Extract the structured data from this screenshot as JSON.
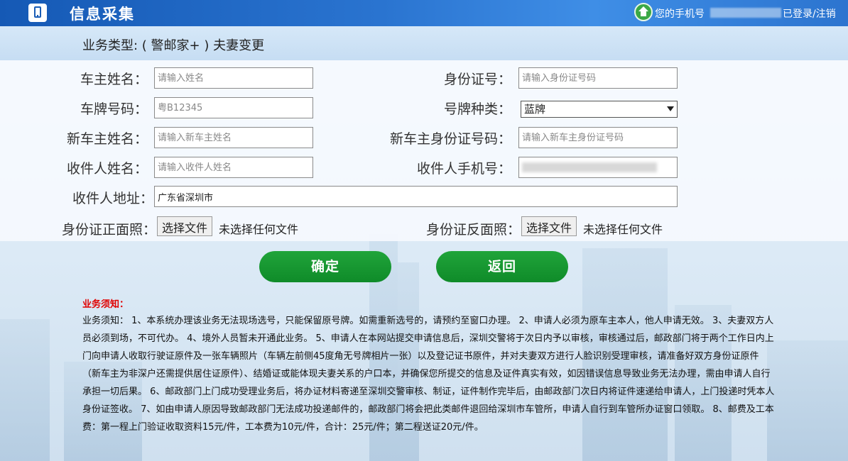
{
  "header": {
    "title": "信息采集",
    "phone_label": "您的手机号",
    "login_status": "已登录/注销"
  },
  "business": {
    "type_text": "业务类型: ( 警邮家+ ) 夫妻变更"
  },
  "form": {
    "owner_name": {
      "label": "车主姓名：",
      "placeholder": "请输入姓名"
    },
    "id_number": {
      "label": "身份证号：",
      "placeholder": "请输入身份证号码"
    },
    "plate_number": {
      "label": "车牌号码：",
      "placeholder": "粤B12345"
    },
    "plate_type": {
      "label": "号牌种类：",
      "value": "蓝牌"
    },
    "new_owner_name": {
      "label": "新车主姓名：",
      "placeholder": "请输入新车主姓名"
    },
    "new_owner_id": {
      "label": "新车主身份证号码：",
      "placeholder": "请输入新车主身份证号码"
    },
    "recipient_name": {
      "label": "收件人姓名：",
      "placeholder": "请输入收件人姓名"
    },
    "recipient_phone": {
      "label": "收件人手机号："
    },
    "recipient_address": {
      "label": "收件人地址：",
      "value": "广东省深圳市"
    },
    "id_front": {
      "label": "身份证正面照：",
      "button": "选择文件",
      "status": "未选择任何文件"
    },
    "id_back": {
      "label": "身份证反面照：",
      "button": "选择文件",
      "status": "未选择任何文件"
    }
  },
  "actions": {
    "confirm": "确定",
    "back": "返回"
  },
  "notice": {
    "title": "业务须知：",
    "text": "业务须知： 1、本系统办理该业务无法现场选号，只能保留原号牌。如需重新选号的，请预约至窗口办理。 2、申请人必须为原车主本人，他人申请无效。 3、夫妻双方人员必须到场，不可代办。 4、境外人员暂未开通此业务。 5、申请人在本网站提交申请信息后，深圳交警将于次日内予以审核，审核通过后，邮政部门将于两个工作日内上门向申请人收取行驶证原件及一张车辆照片（车辆左前侧45度角无号牌相片一张）以及登记证书原件，并对夫妻双方进行人脸识别受理审核，请准备好双方身份证原件（新车主为非深户还需提供居住证原件）、结婚证或能体现夫妻关系的户口本，并确保您所提交的信息及证件真实有效，如因错误信息导致业务无法办理，需由申请人自行承担一切后果。 6、邮政部门上门成功受理业务后，将办证材料寄递至深圳交警审核、制证，证件制作完毕后，由邮政部门次日内将证件速递给申请人，上门投递时凭本人身份证签收。 7、如由申请人原因导致邮政部门无法成功投递邮件的，邮政部门将会把此类邮件退回给深圳市车管所，申请人自行到车管所办证窗口领取。 8、邮费及工本费：第一程上门验证收取资料15元/件，工本费为10元/件，合计：25元/件；第二程送证20元/件。"
  }
}
